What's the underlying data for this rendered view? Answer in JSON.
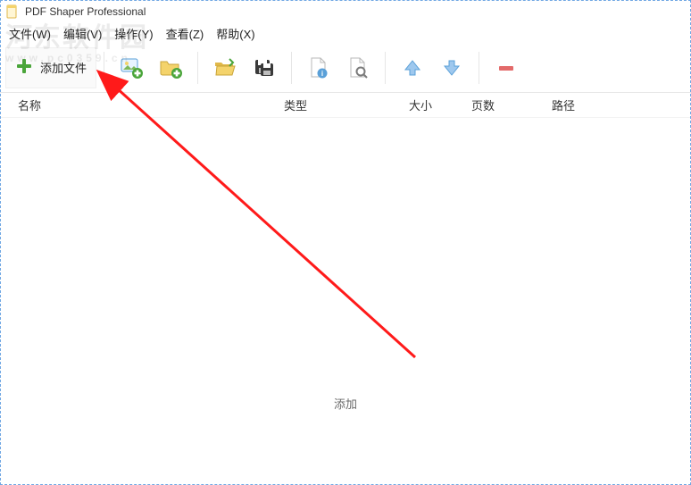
{
  "window": {
    "title": "PDF Shaper Professional"
  },
  "menu": {
    "file": "文件(W)",
    "edit": "编辑(V)",
    "action": "操作(Y)",
    "view": "查看(Z)",
    "help": "帮助(X)"
  },
  "toolbar": {
    "add_file_label": "添加文件"
  },
  "columns": {
    "name": "名称",
    "type": "类型",
    "size": "大小",
    "pages": "页数",
    "path": "路径"
  },
  "empty_hint": "添加",
  "watermark": {
    "line1": "河东软件园",
    "line2": "www.pc0359.cn"
  }
}
